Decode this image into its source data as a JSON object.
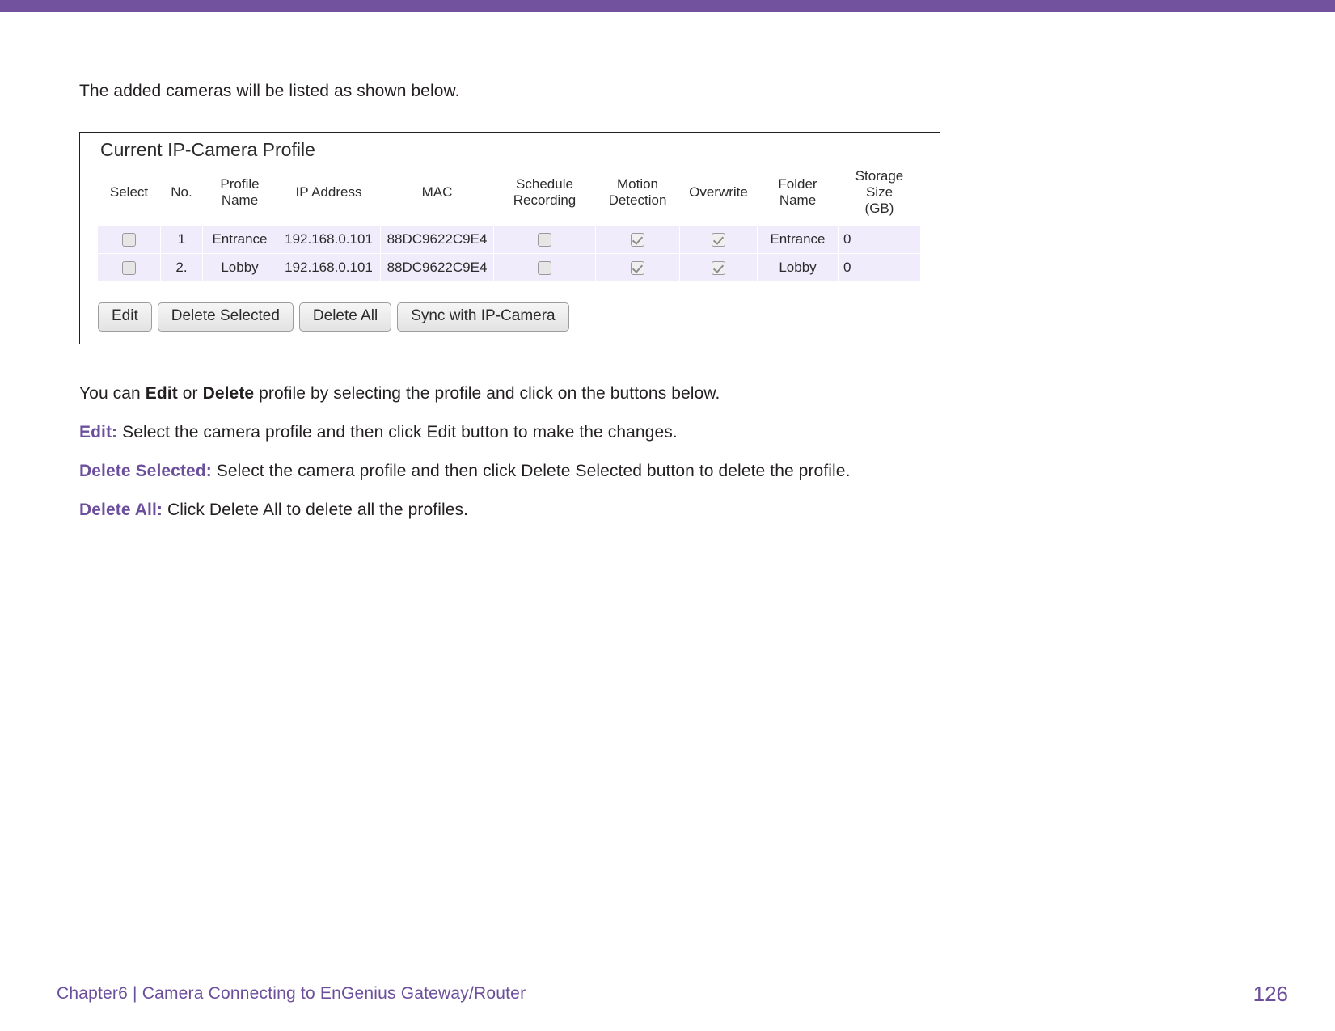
{
  "theme": {
    "accent": "#72529F",
    "label_purple": "#6C4F9C",
    "body_text": "#231F20",
    "table_row_bg": "#F1ECFB"
  },
  "intro": {
    "text": "The added cameras will be listed as shown below."
  },
  "figure": {
    "title": "Current IP-Camera Profile",
    "columns": [
      "Select",
      "No.",
      "Profile\nName",
      "IP Address",
      "MAC",
      "Schedule\nRecording",
      "Motion\nDetection",
      "Overwrite",
      "Folder\nName",
      "Storage\nSize\n(GB)"
    ],
    "columns_display": {
      "select": "Select",
      "no": "No.",
      "profile_name_l1": "Profile",
      "profile_name_l2": "Name",
      "ip_address": "IP Address",
      "mac": "MAC",
      "schedule_l1": "Schedule",
      "schedule_l2": "Recording",
      "motion_l1": "Motion",
      "motion_l2": "Detection",
      "overwrite": "Overwrite",
      "folder_l1": "Folder",
      "folder_l2": "Name",
      "storage_l1": "Storage",
      "storage_l2": "Size",
      "storage_l3": "(GB)"
    },
    "rows": [
      {
        "select": false,
        "no": "1",
        "profile_name": "Entrance",
        "ip_address": "192.168.0.101",
        "mac": "88DC9622C9E4",
        "schedule_recording": false,
        "motion_detection": true,
        "overwrite": true,
        "folder_name": "Entrance",
        "storage_size": "0"
      },
      {
        "select": false,
        "no": "2.",
        "profile_name": "Lobby",
        "ip_address": "192.168.0.101",
        "mac": "88DC9622C9E4",
        "schedule_recording": false,
        "motion_detection": true,
        "overwrite": true,
        "folder_name": "Lobby",
        "storage_size": "0"
      }
    ],
    "buttons": {
      "edit": "Edit",
      "delete_selected": "Delete Selected",
      "delete_all": "Delete All",
      "sync": "Sync with IP-Camera"
    }
  },
  "notes": {
    "summary_p1": "You can ",
    "summary_edit": "Edit",
    "summary_p2": " or ",
    "summary_delete": "Delete",
    "summary_p3": " profile by selecting the profile and click on the buttons below.",
    "edit_label": "Edit:",
    "edit_text": " Select the camera profile and then click Edit button to make the changes.",
    "delete_selected_label": "Delete Selected:",
    "delete_selected_text": " Select the camera profile and then click Delete Selected button to delete the profile.",
    "delete_all_label": "Delete All:",
    "delete_all_text": " Click Delete All to delete all the profiles."
  },
  "footer": {
    "chapter": "Chapter6  |  Camera Connecting to EnGenius Gateway/Router",
    "page_number": "126"
  }
}
